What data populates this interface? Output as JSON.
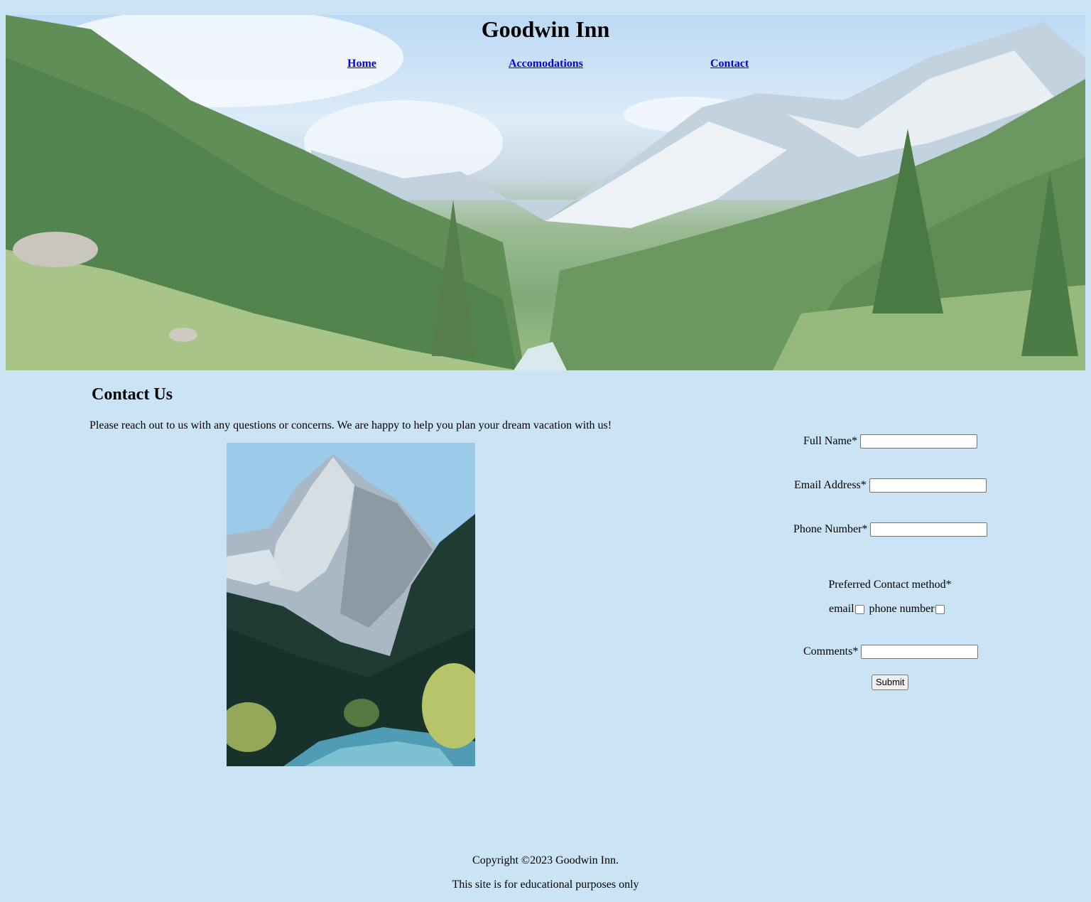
{
  "site": {
    "title": "Goodwin Inn"
  },
  "nav": {
    "items": [
      {
        "label": "Home"
      },
      {
        "label": "Accomodations"
      },
      {
        "label": "Contact"
      }
    ]
  },
  "contact": {
    "heading": "Contact Us",
    "intro": "Please reach out to us with any questions or concerns. We are happy to help you plan your dream vacation with us!"
  },
  "form": {
    "full_name_label": "Full Name*",
    "full_name_value": "",
    "email_label": "Email Address*",
    "email_value": "",
    "phone_label": "Phone Number*",
    "phone_value": "",
    "preferred_label": "Preferred Contact method*",
    "option_email": "email",
    "option_phone": "phone number",
    "comments_label": "Comments*",
    "comments_value": "",
    "submit_label": "Submit"
  },
  "footer": {
    "copyright": "Copyright ©2023 Goodwin Inn.",
    "disclaimer": "This site is for educational purposes only"
  },
  "colors": {
    "page_background": "#cae4f6",
    "link": "#0000ee"
  }
}
